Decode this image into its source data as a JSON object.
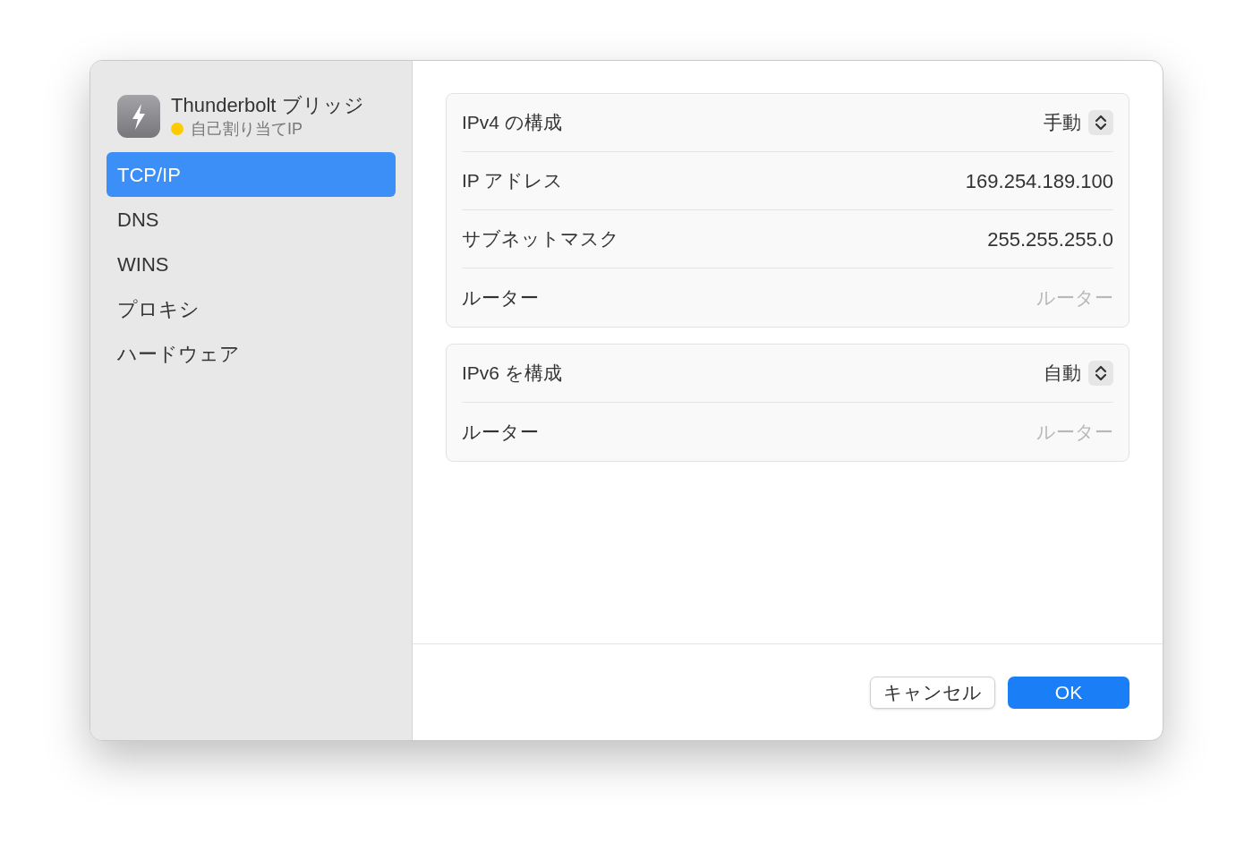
{
  "interface": {
    "name": "Thunderbolt ブリッジ",
    "status": "自己割り当てIP",
    "color": "#fecb00"
  },
  "sidebar": {
    "items": [
      {
        "label": "TCP/IP",
        "selected": true
      },
      {
        "label": "DNS",
        "selected": false
      },
      {
        "label": "WINS",
        "selected": false
      },
      {
        "label": "プロキシ",
        "selected": false
      },
      {
        "label": "ハードウェア",
        "selected": false
      }
    ]
  },
  "groups": [
    {
      "rows": [
        {
          "label": "IPv4 の構成",
          "kind": "popup",
          "value": "手動"
        },
        {
          "label": "IP アドレス",
          "kind": "value",
          "value": "169.254.189.100"
        },
        {
          "label": "サブネットマスク",
          "kind": "value",
          "value": "255.255.255.0"
        },
        {
          "label": "ルーター",
          "kind": "field",
          "placeholder": "ルーター"
        }
      ]
    },
    {
      "rows": [
        {
          "label": "IPv6 を構成",
          "kind": "popup",
          "value": "自動"
        },
        {
          "label": "ルーター",
          "kind": "field",
          "placeholder": "ルーター"
        }
      ]
    }
  ],
  "buttons": [
    {
      "label": "キャンセル",
      "default": false
    },
    {
      "label": "OK",
      "default": true
    }
  ]
}
